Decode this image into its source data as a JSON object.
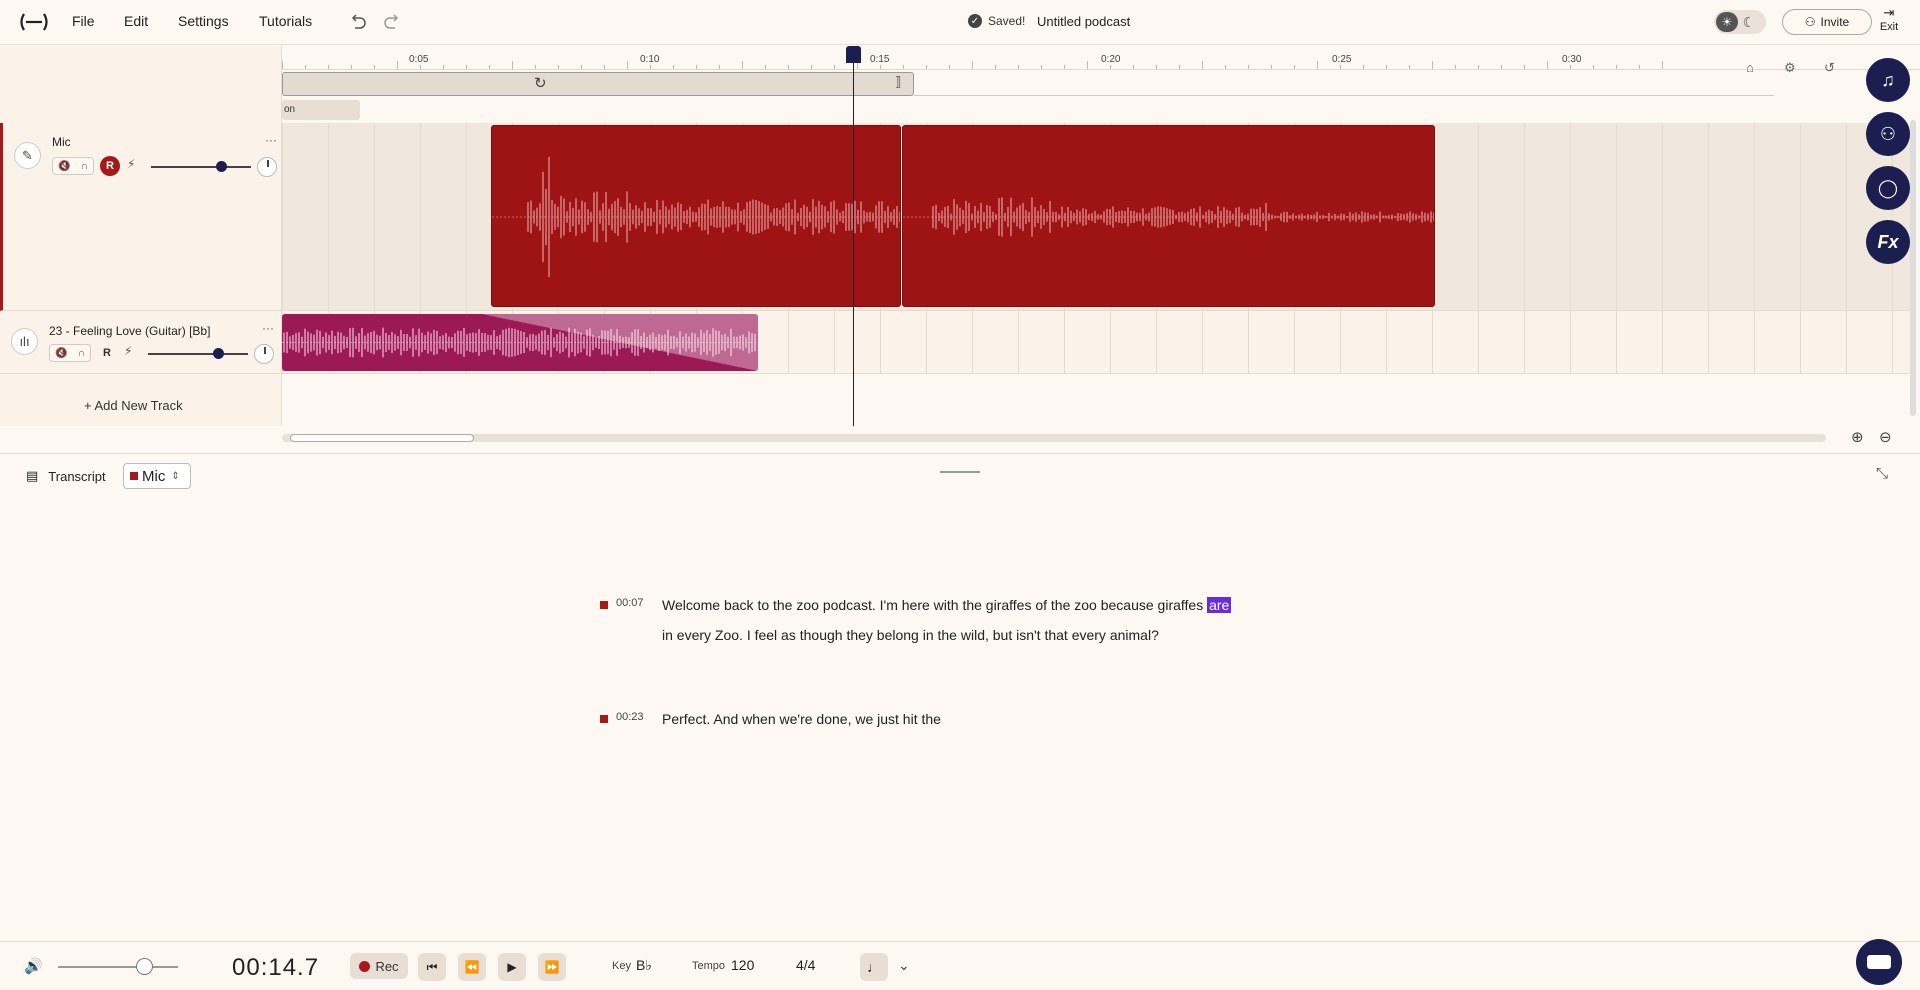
{
  "menu": {
    "file": "File",
    "edit": "Edit",
    "settings": "Settings",
    "tutorials": "Tutorials"
  },
  "status": {
    "saved": "Saved!",
    "project_title": "Untitled podcast"
  },
  "header": {
    "invite": "Invite",
    "exit": "Exit"
  },
  "ruler": {
    "ticks": [
      "0:05",
      "0:10",
      "0:15",
      "0:20",
      "0:25",
      "0:30"
    ]
  },
  "marker_label": "on",
  "tracks": [
    {
      "name": "Mic",
      "rec": "R",
      "color": "#9e1414"
    },
    {
      "name": "23 - Feeling Love (Guitar) [Bb]",
      "rec": "R",
      "color": "#9b1a56"
    }
  ],
  "add_track": "+ Add New Track",
  "transcript": {
    "label": "Transcript",
    "source": "Mic",
    "segments": [
      {
        "time": "00:07",
        "before": "Welcome back to the zoo podcast. I'm here with the giraffes of the zoo because giraffes ",
        "highlight": "are",
        "after": " in every Zoo. I feel as though they belong in the wild, but isn't that every animal?"
      },
      {
        "time": "00:23",
        "before": "Perfect. And when we're done, we just hit the",
        "highlight": "",
        "after": ""
      }
    ]
  },
  "transport": {
    "time": "00:14.7",
    "rec": "Rec",
    "key_label": "Key",
    "key_value": "B♭",
    "tempo_label": "Tempo",
    "tempo_value": "120",
    "signature": "4/4"
  },
  "colors": {
    "accent": "#1c1e4f",
    "mic_clip": "#9e1414",
    "music_clip": "#9b1a56",
    "highlight": "#6a2bd9"
  }
}
